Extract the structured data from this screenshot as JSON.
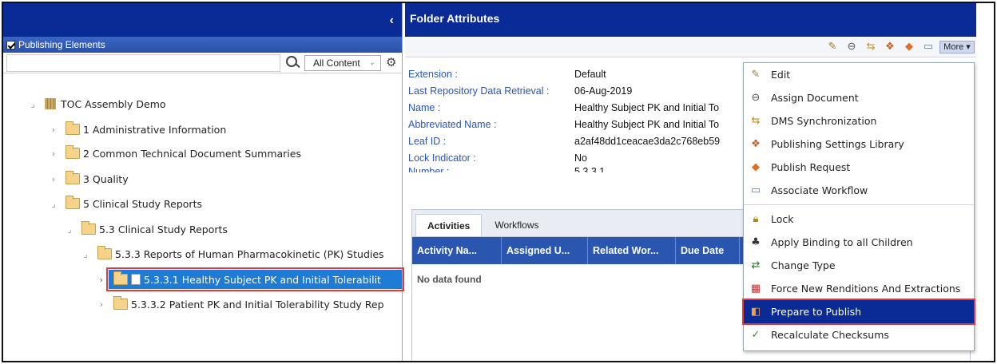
{
  "left": {
    "panel_label": "Publishing Elements",
    "search_placeholder": "",
    "filter_selected": "All Content",
    "tree": [
      {
        "label": "TOC Assembly Demo",
        "toggle": "⌟",
        "type": "book"
      },
      {
        "label": "1 Administrative Information",
        "toggle": "›",
        "type": "folder"
      },
      {
        "label": "2 Common Technical Document Summaries",
        "toggle": "›",
        "type": "folder"
      },
      {
        "label": "3 Quality",
        "toggle": "›",
        "type": "folder"
      },
      {
        "label": "5 Clinical Study Reports",
        "toggle": "⌟",
        "type": "folder"
      },
      {
        "label": "5.3 Clinical Study Reports",
        "toggle": "⌟",
        "type": "folder"
      },
      {
        "label": "5.3.3 Reports of Human Pharmacokinetic (PK) Studies",
        "toggle": "⌟",
        "type": "folder"
      },
      {
        "label": "5.3.3.1 Healthy Subject PK and Initial Tolerabilit",
        "toggle": "›",
        "type": "folder",
        "selected": true
      },
      {
        "label": "5.3.3.2 Patient PK and Initial Tolerability Study Rep",
        "toggle": "›",
        "type": "folder"
      }
    ]
  },
  "right": {
    "title": "Folder Attributes",
    "more_label": "More ▾",
    "attributes": [
      {
        "label": "Extension :",
        "value": "Default"
      },
      {
        "label": "Last Repository Data Retrieval :",
        "value": "06-Aug-2019"
      },
      {
        "label": "Name :",
        "value": "Healthy Subject PK and Initial To"
      },
      {
        "label": "Abbreviated Name :",
        "value": "Healthy Subject PK and Initial To"
      },
      {
        "label": "Leaf ID :",
        "value": "a2af48dd1ceacae3da2c768eb59"
      },
      {
        "label": "Lock Indicator :",
        "value": "No"
      },
      {
        "label": "Number :",
        "value": "5.3.3.1"
      }
    ],
    "tabs": [
      "Activities",
      "Workflows"
    ],
    "grid_columns": [
      "Activity Na...",
      "Assigned U...",
      "Related Wor...",
      "Due Date"
    ],
    "no_data": "No data found"
  },
  "menu": {
    "items": [
      {
        "label": "Edit",
        "icon": "edit-icon"
      },
      {
        "label": "Assign Document",
        "icon": "link-icon"
      },
      {
        "label": "DMS Synchronization",
        "icon": "sync-icon"
      },
      {
        "label": "Publishing Settings Library",
        "icon": "library-icon"
      },
      {
        "label": "Publish Request",
        "icon": "publish-icon"
      },
      {
        "label": "Associate Workflow",
        "icon": "workflow-icon"
      },
      {
        "label": "Lock",
        "icon": "lock-icon"
      },
      {
        "label": "Apply Binding to all Children",
        "icon": "binding-icon"
      },
      {
        "label": "Change Type",
        "icon": "change-type-icon"
      },
      {
        "label": "Force New Renditions And Extractions",
        "icon": "rendition-icon"
      },
      {
        "label": "Prepare to Publish",
        "icon": "prepare-icon",
        "highlighted": true
      },
      {
        "label": "Recalculate Checksums",
        "icon": "checksum-icon"
      }
    ]
  },
  "colors": {
    "header": "#0a2a96",
    "selection": "#1e7bd6",
    "highlight_border": "#e03a3a"
  }
}
